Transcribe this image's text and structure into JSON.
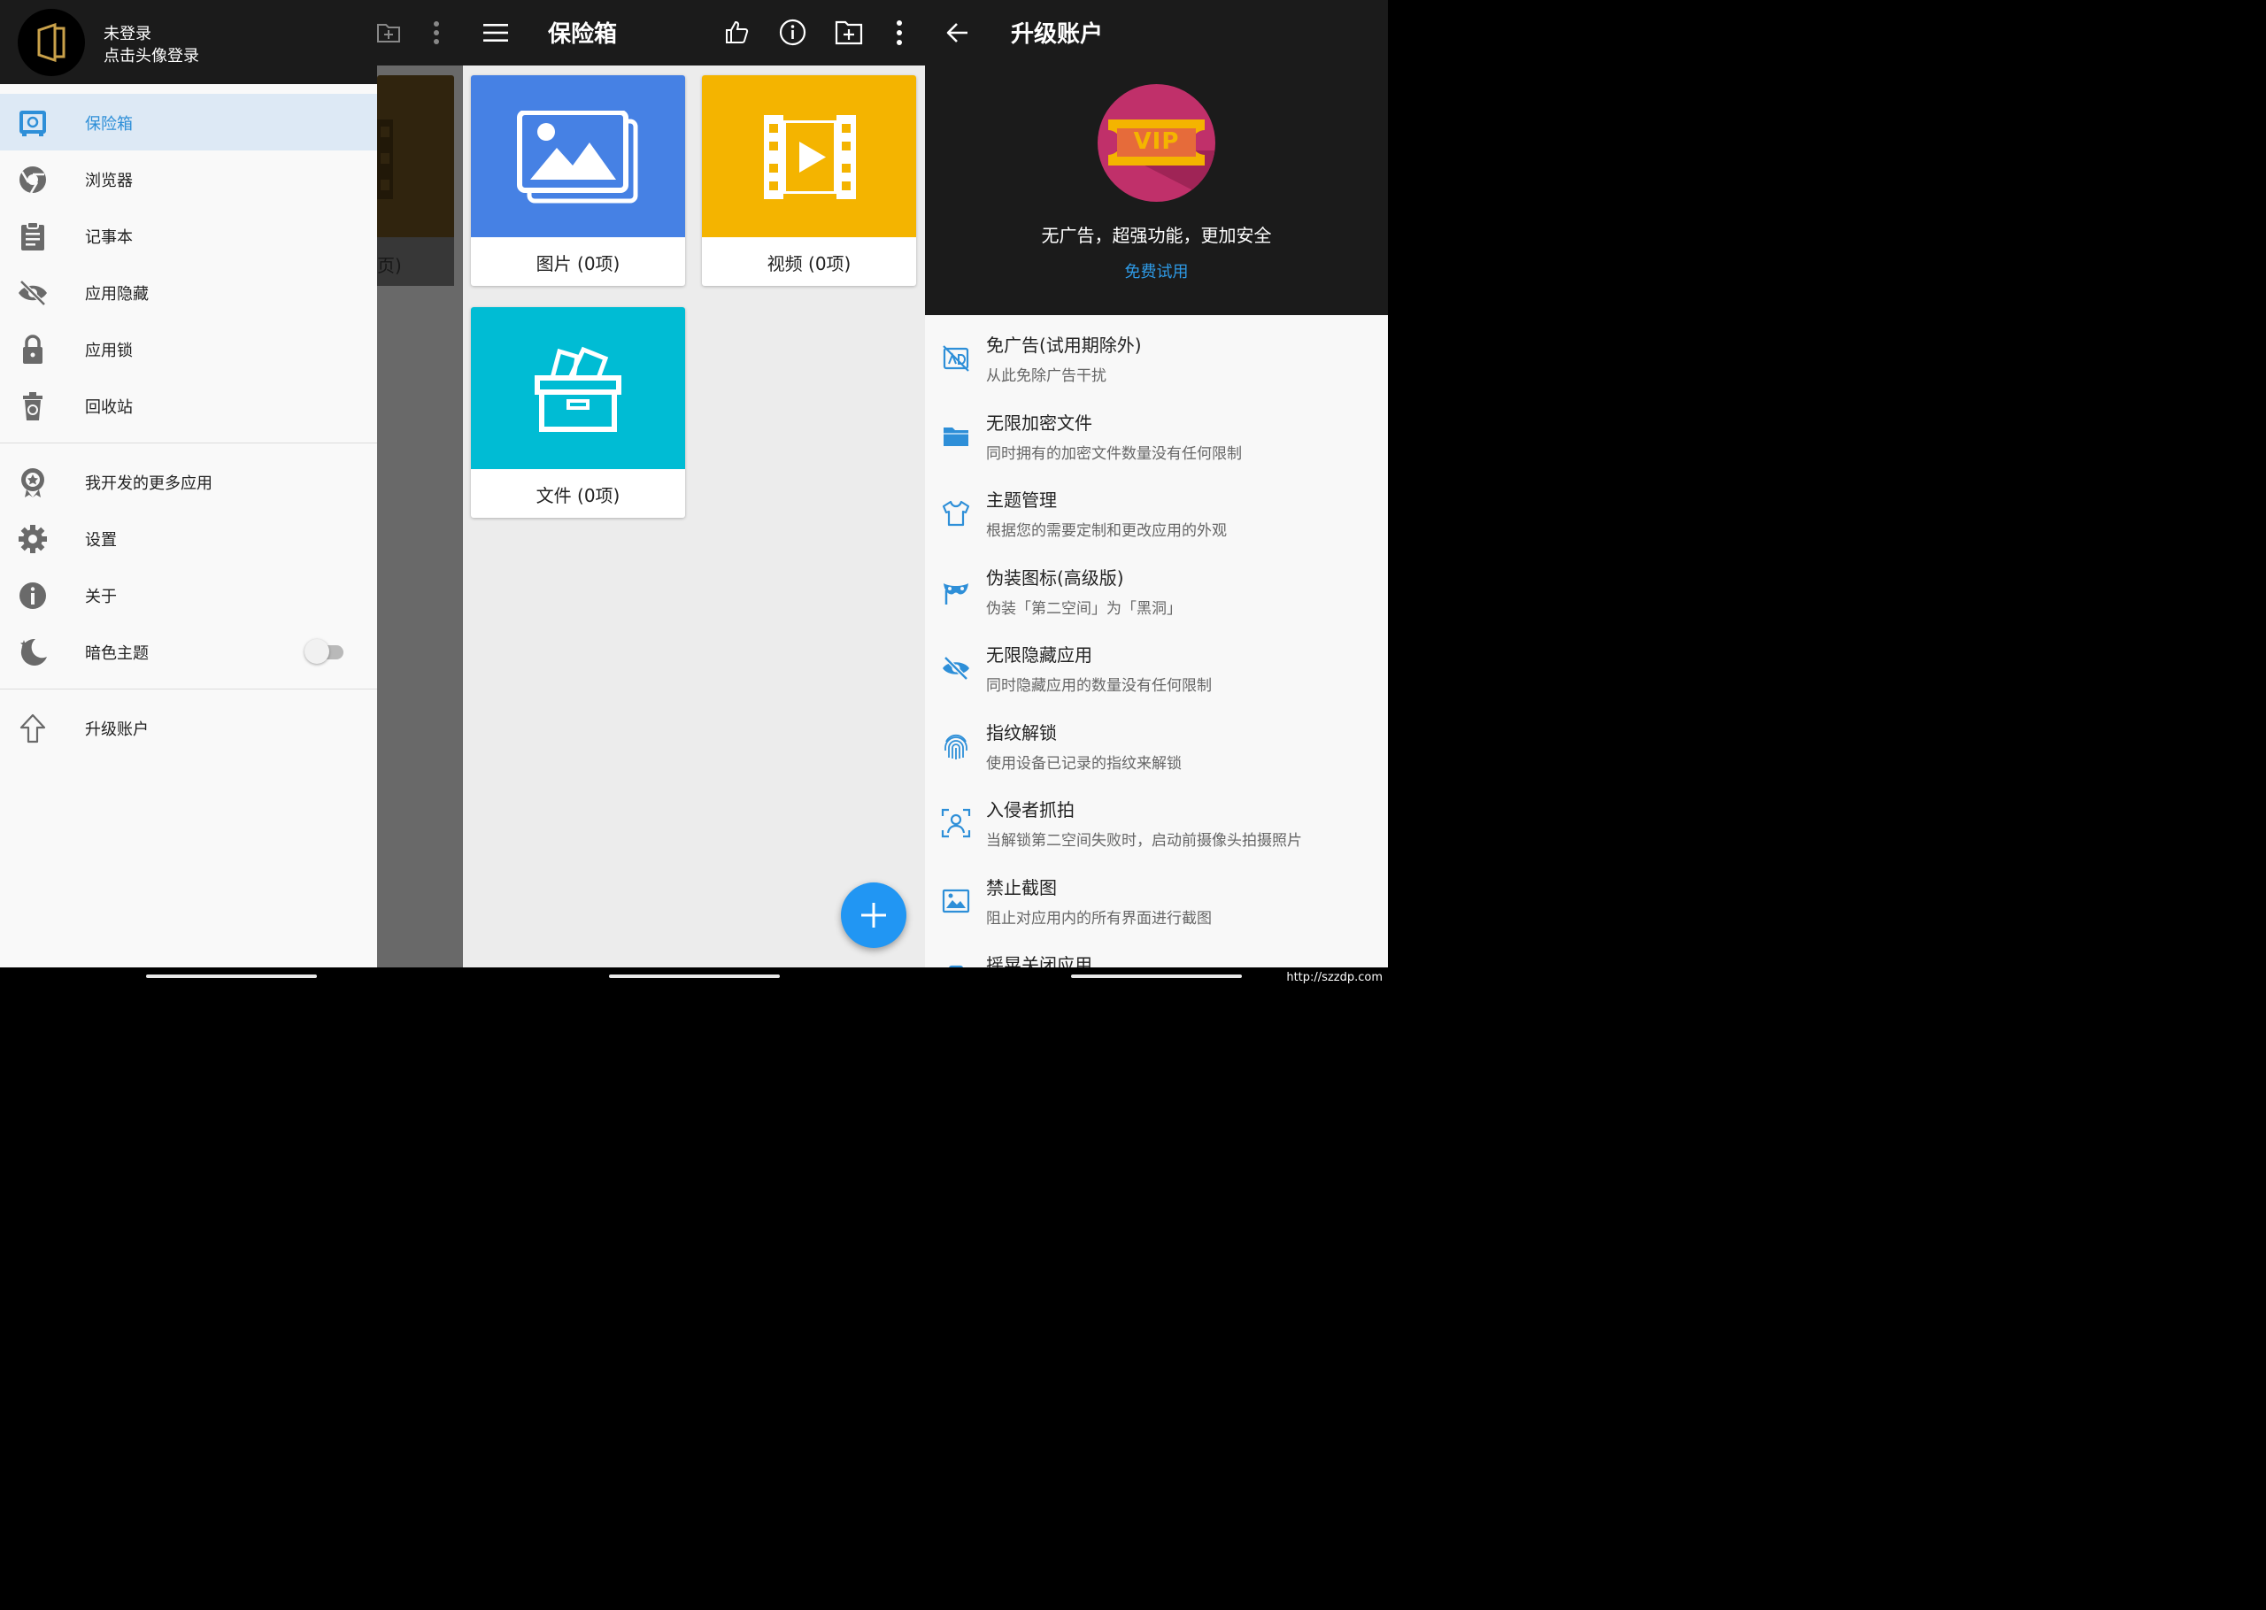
{
  "drawer": {
    "header": {
      "line1": "未登录",
      "line2": "点击头像登录"
    },
    "items": [
      {
        "label": "保险箱"
      },
      {
        "label": "浏览器"
      },
      {
        "label": "记事本"
      },
      {
        "label": "应用隐藏"
      },
      {
        "label": "应用锁"
      },
      {
        "label": "回收站"
      },
      {
        "label": "我开发的更多应用"
      },
      {
        "label": "设置"
      },
      {
        "label": "关于"
      },
      {
        "label": "暗色主题"
      },
      {
        "label": "升级账户"
      }
    ],
    "dark_theme_enabled": false,
    "behind_tile_label_fragment": "页)"
  },
  "vault": {
    "title": "保险箱",
    "tiles": [
      {
        "label": "图片 (0项)",
        "color": "#4681e4"
      },
      {
        "label": "视频 (0项)",
        "color": "#f4b400"
      },
      {
        "label": "文件 (0项)",
        "color": "#00bcd4"
      }
    ]
  },
  "upgrade": {
    "title": "升级账户",
    "badge_text": "VIP",
    "tagline": "无广告，超强功能，更加安全",
    "trial_link": "免费试用",
    "features": [
      {
        "title": "免广告(试用期除外)",
        "subtitle": "从此免除广告干扰"
      },
      {
        "title": "无限加密文件",
        "subtitle": "同时拥有的加密文件数量没有任何限制"
      },
      {
        "title": "主题管理",
        "subtitle": "根据您的需要定制和更改应用的外观"
      },
      {
        "title": "伪装图标(高级版)",
        "subtitle": "伪装「第二空间」为「黑洞」"
      },
      {
        "title": "无限隐藏应用",
        "subtitle": "同时隐藏应用的数量没有任何限制"
      },
      {
        "title": "指纹解锁",
        "subtitle": "使用设备已记录的指纹来解锁"
      },
      {
        "title": "入侵者抓拍",
        "subtitle": "当解锁第二空间失败时，启动前摄像头拍摄照片"
      },
      {
        "title": "禁止截图",
        "subtitle": "阻止对应用内的所有界面进行截图"
      },
      {
        "title": "摇晃关闭应用",
        "subtitle": ""
      }
    ]
  },
  "colors": {
    "accent": "#2e8fd8",
    "fab": "#2196f3",
    "toolbar": "#1b1b1b",
    "vip_circle": "#c0306a",
    "vip_ticket": "#f4b400"
  },
  "watermark": "http://szzdp.com"
}
